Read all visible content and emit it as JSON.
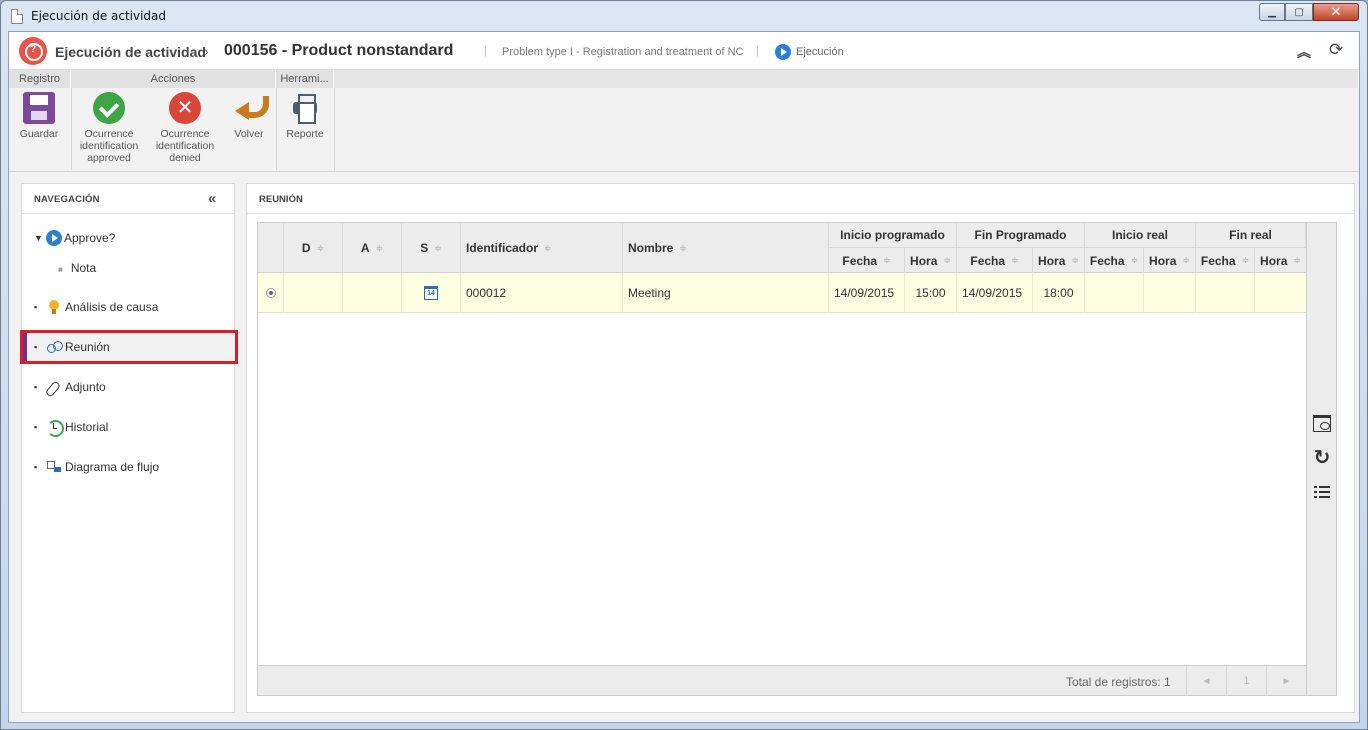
{
  "window": {
    "title": "Ejecución de actividad"
  },
  "header": {
    "breadcrumb_root": "Ejecución de actividad",
    "breadcrumb_current": "000156 - Product nonstandard",
    "problem_type": "Problem type I - Registration and treatment of NC",
    "status": "Ejecución"
  },
  "ribbon": {
    "groups": [
      {
        "label": "Registro"
      },
      {
        "label": "Acciones"
      },
      {
        "label": "Herrami..."
      }
    ],
    "buttons": {
      "save": "Guardar",
      "approved_l1": "Ocurrence",
      "approved_l2": "identification",
      "approved_l3": "approved",
      "denied_l1": "Ocurrence",
      "denied_l2": "identification",
      "denied_l3": "denied",
      "back": "Volver",
      "report": "Reporte"
    }
  },
  "navigation": {
    "title": "NAVEGACIÓN",
    "items": [
      {
        "label": "Approve?"
      },
      {
        "label": "Nota"
      },
      {
        "label": "Análisis de causa"
      },
      {
        "label": "Reunión"
      },
      {
        "label": "Adjunto"
      },
      {
        "label": "Historial"
      },
      {
        "label": "Diagrama de flujo"
      }
    ]
  },
  "main": {
    "title": "REUNIÓN",
    "columns": {
      "d": "D",
      "a": "A",
      "s": "S",
      "id": "Identificador",
      "name": "Nombre",
      "group_sched_start": "Inicio programado",
      "group_sched_end": "Fin Programado",
      "group_real_start": "Inicio real",
      "group_real_end": "Fin real",
      "fecha": "Fecha",
      "hora": "Hora"
    },
    "rows": [
      {
        "calendar_day": "14",
        "id": "000012",
        "name": "Meeting",
        "sched_start_date": "14/09/2015",
        "sched_start_time": "15:00",
        "sched_end_date": "14/09/2015",
        "sched_end_time": "18:00",
        "real_start_date": "",
        "real_start_time": "",
        "real_end_date": "",
        "real_end_time": ""
      }
    ],
    "footer": {
      "total": "Total de registros: 1",
      "page": "1",
      "prev": "◄",
      "next": "►"
    }
  },
  "colors": {
    "accent_purple": "#6f2d8d",
    "highlight_red": "#d62027",
    "row_selected": "#fdfde1",
    "approve_green": "#3da546",
    "deny_red": "#d9473b"
  }
}
